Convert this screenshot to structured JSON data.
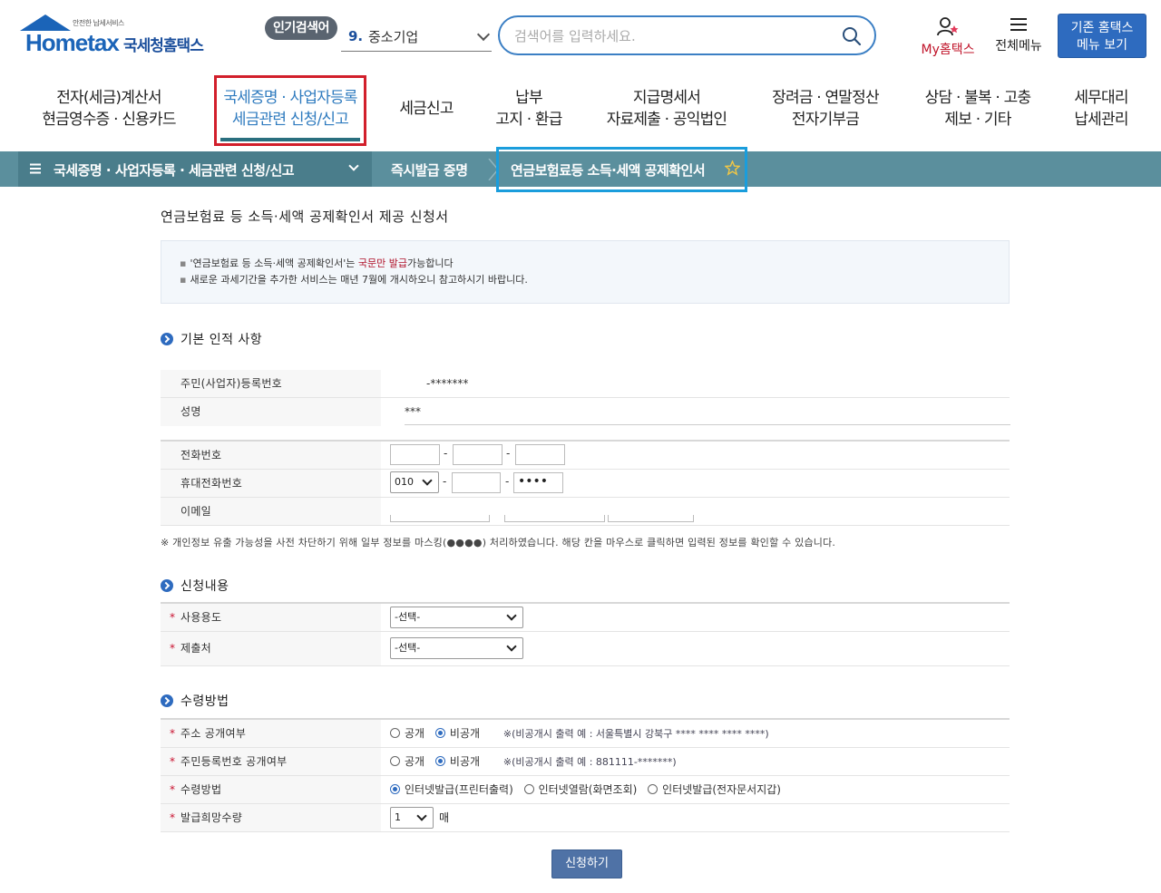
{
  "logo": {
    "tagline": "안전한 납세서비스",
    "brand": "Hometax",
    "name": "국세청홈택스"
  },
  "popular": {
    "badge": "인기검색어",
    "rank": "9.",
    "keyword": "중소기업"
  },
  "search": {
    "placeholder": "검색어를 입력하세요."
  },
  "header": {
    "my_hometax": "My홈택스",
    "all_menu": "전체메뉴",
    "legacy_line1": "기존 홈택스",
    "legacy_line2": "메뉴 보기"
  },
  "gnb": [
    {
      "label": "전자(세금)계산서\n현금영수증 · 신용카드"
    },
    {
      "label": "국세증명 · 사업자등록\n세금관련 신청/신고"
    },
    {
      "label": "세금신고"
    },
    {
      "label": "납부\n고지 · 환급"
    },
    {
      "label": "지급명세서\n자료제출 · 공익법인"
    },
    {
      "label": "장려금 · 연말정산\n전자기부금"
    },
    {
      "label": "상담 · 불복 · 고충\n제보 · 기타"
    },
    {
      "label": "세무대리\n납세관리"
    }
  ],
  "breadcrumb": {
    "level1": "국세증명 · 사업자등록 · 세금관련 신청/신고",
    "level2": "즉시발급 증명",
    "level3": "연금보험료등 소득·세액 공제확인서"
  },
  "page": {
    "title": "연금보험료 등 소득·세액 공제확인서 제공 신청서",
    "notice1_pre": "'연금보험료 등 소득·세액 공제확인서'는 ",
    "notice1_red": "국문만 발급",
    "notice1_post": "가능합니다",
    "notice2": "새로운 과세기간을 추가한 서비스는 매년 7월에 개시하오니 참고하시기 바랍니다."
  },
  "basic": {
    "section_title": "기본 인적 사항",
    "rrn_label": "주민(사업자)등록번호",
    "rrn_value": "-*******",
    "name_label": "성명",
    "name_value": "***",
    "phone_label": "전화번호",
    "mobile_label": "휴대전화번호",
    "mobile_prefix": "010",
    "mobile_last": "••••",
    "email_label": "이메일",
    "mask_note": "※ 개인정보 유출 가능성을 사전 차단하기 위해 일부 정보를 마스킹(●●●●) 처리하였습니다. 해당 칸을 마우스로 클릭하면 입력된 정보를 확인할 수 있습니다."
  },
  "apply": {
    "section_title": "신청내용",
    "purpose_label": "사용용도",
    "purpose_value": "-선택-",
    "submit_to_label": "제출처",
    "submit_to_value": "-선택-"
  },
  "receive": {
    "section_title": "수령방법",
    "addr_label": "주소 공개여부",
    "rrn_label": "주민등록번호 공개여부",
    "method_label": "수령방법",
    "qty_label": "발급희망수량",
    "public": "공개",
    "private": "비공개",
    "addr_hint": "※(비공개시 출력 예 : 서울특별시 강북구 **** **** **** ****)",
    "rrn_hint": "※(비공개시 출력 예 : 881111-*******)",
    "method_opt1": "인터넷발급(프린터출력)",
    "method_opt2": "인터넷열람(화면조회)",
    "method_opt3": "인터넷발급(전자문서지갑)",
    "qty_value": "1",
    "qty_unit": "매"
  },
  "submit_label": "신청하기",
  "colors": {
    "brand_blue": "#2e6bbf",
    "breadcrumb_teal": "#5b8f9d",
    "active_red_box": "#d21f2b",
    "highlight_blue_box": "#1a9ddc"
  }
}
